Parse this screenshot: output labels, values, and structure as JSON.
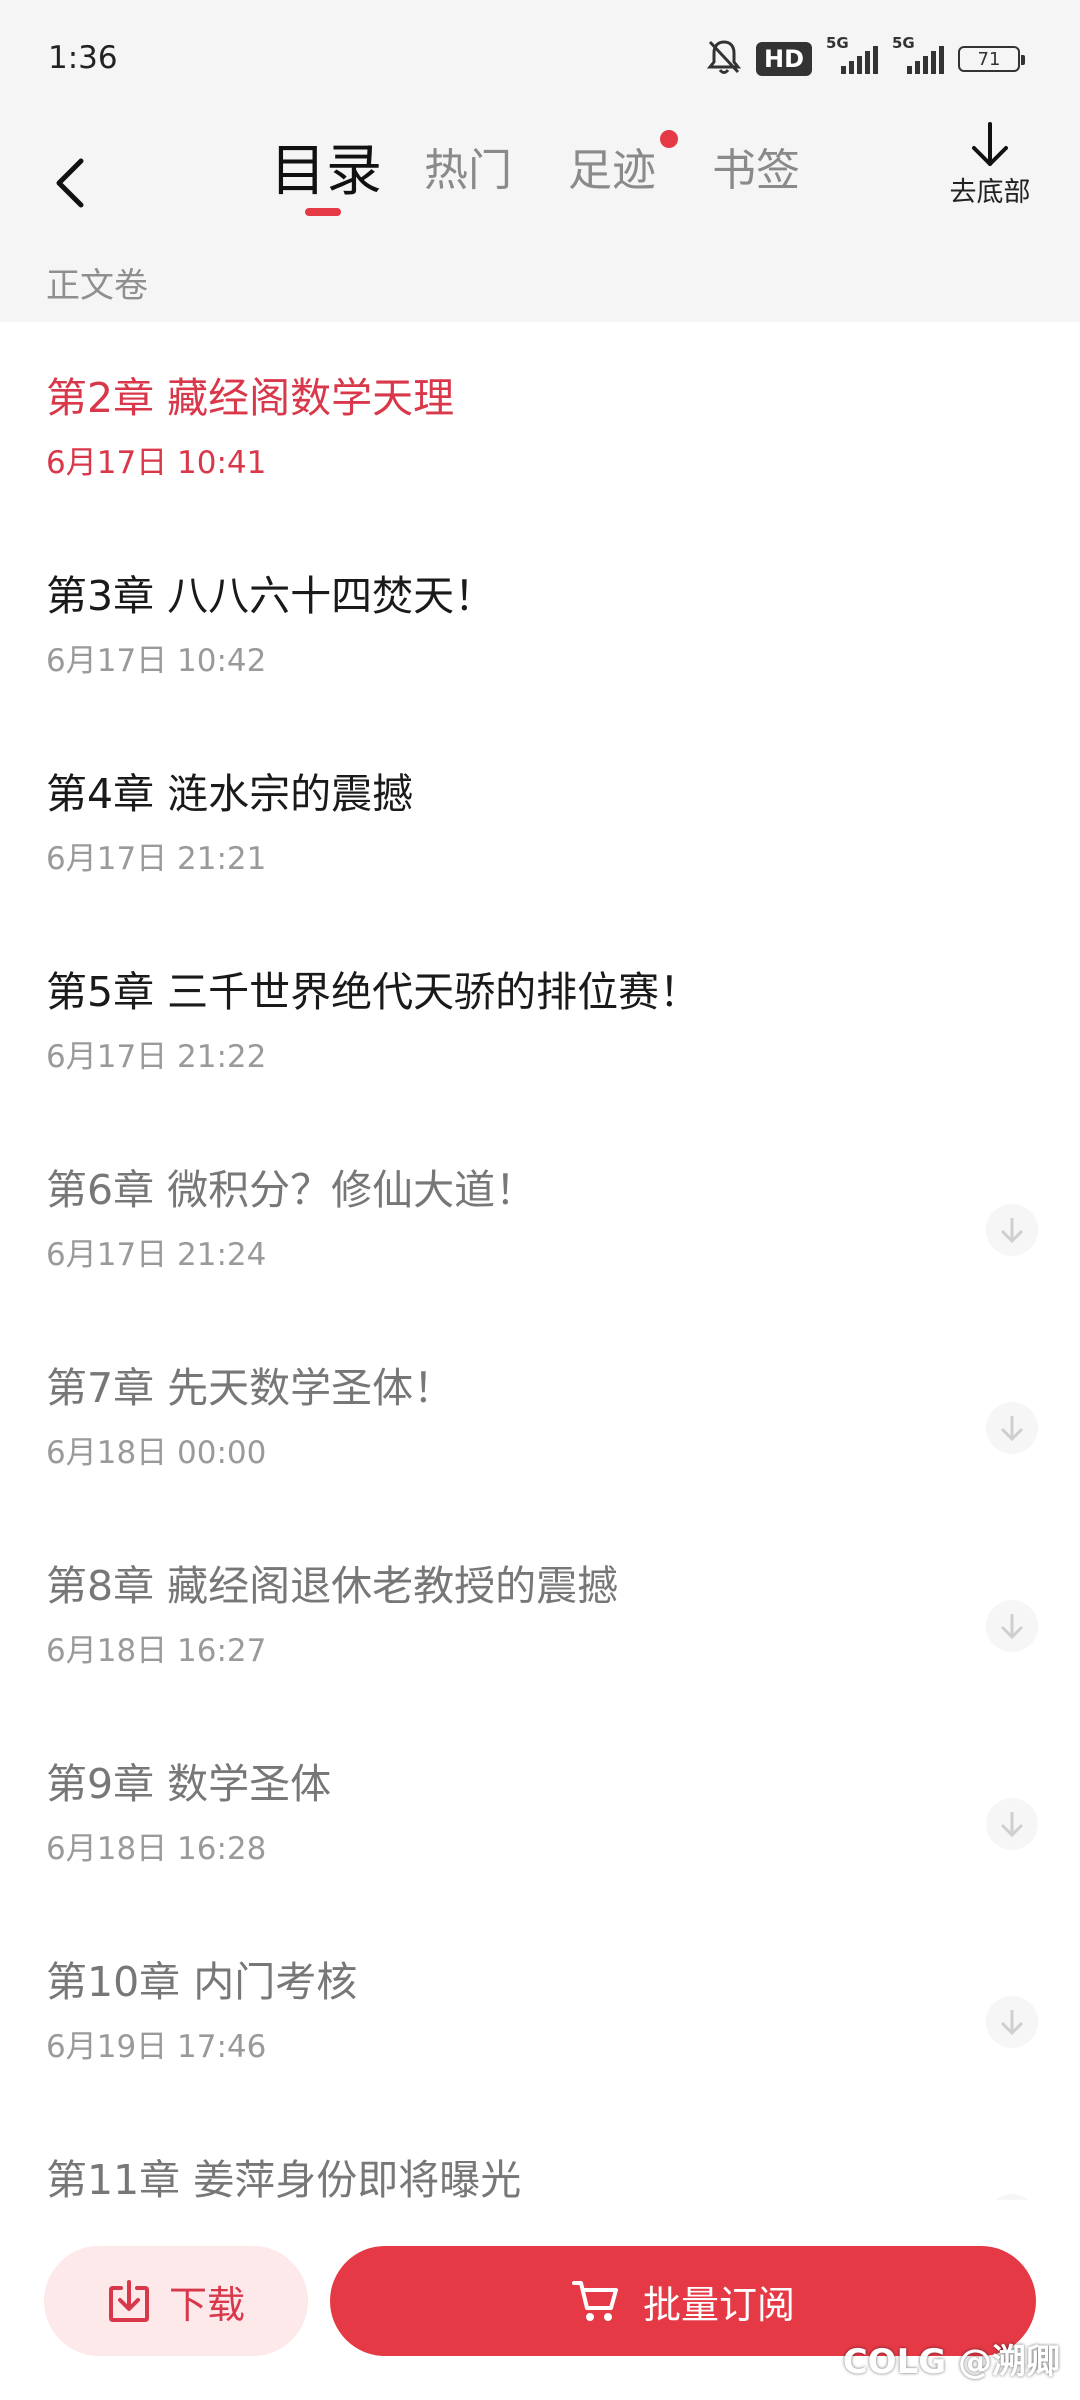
{
  "status_bar": {
    "time": "1:36",
    "hd": "HD",
    "signal1": "5G",
    "signal2": "5G",
    "battery": "71"
  },
  "nav": {
    "tabs": [
      {
        "label": "目录",
        "active": true
      },
      {
        "label": "热门",
        "active": false
      },
      {
        "label": "足迹",
        "active": false,
        "dot": true
      },
      {
        "label": "书签",
        "active": false
      }
    ],
    "to_bottom_label": "去底部"
  },
  "section_title": "正文卷",
  "chapters": [
    {
      "title": "第2章 藏经阁数学天理",
      "date": "6月17日 10:41",
      "state": "current"
    },
    {
      "title": "第3章 八八六十四焚天！",
      "date": "6月17日 10:42",
      "state": "read"
    },
    {
      "title": "第4章 涟水宗的震撼",
      "date": "6月17日 21:21",
      "state": "read"
    },
    {
      "title": "第5章 三千世界绝代天骄的排位赛！",
      "date": "6月17日 21:22",
      "state": "read"
    },
    {
      "title": "第6章 微积分？修仙大道！",
      "date": "6月17日 21:24",
      "state": "unread"
    },
    {
      "title": "第7章 先天数学圣体！",
      "date": "6月18日 00:00",
      "state": "unread"
    },
    {
      "title": "第8章 藏经阁退休老教授的震撼",
      "date": "6月18日 16:27",
      "state": "unread"
    },
    {
      "title": "第9章 数学圣体",
      "date": "6月18日 16:28",
      "state": "unread"
    },
    {
      "title": "第10章 内门考核",
      "date": "6月19日 17:46",
      "state": "unread"
    },
    {
      "title": "第11章 姜萍身份即将曝光",
      "date": "",
      "state": "unread"
    }
  ],
  "bottom_bar": {
    "download_label": "下载",
    "subscribe_label": "批量订阅"
  },
  "watermark": "COLG @溯卿",
  "colors": {
    "accent": "#e63946",
    "current_text": "#d8384a",
    "muted": "#9a9a9a"
  }
}
